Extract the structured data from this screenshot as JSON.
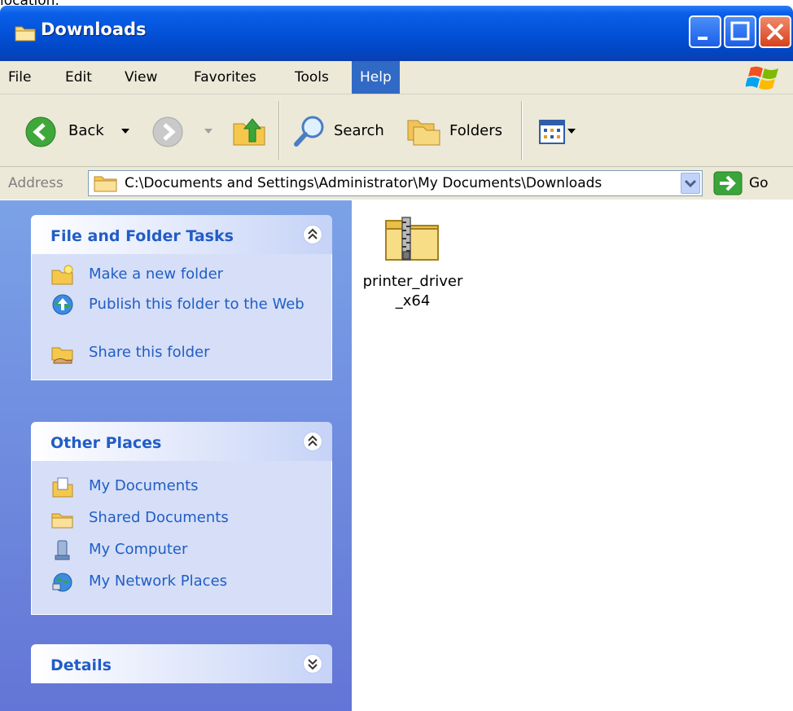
{
  "partial_text": "location.",
  "window": {
    "title": "Downloads",
    "controls": [
      "minimize",
      "maximize",
      "close"
    ]
  },
  "menu": {
    "items": [
      "File",
      "Edit",
      "View",
      "Favorites",
      "Tools",
      "Help"
    ],
    "active": "Help"
  },
  "toolbar": {
    "back_label": "Back",
    "search_label": "Search",
    "folders_label": "Folders"
  },
  "address": {
    "label": "Address",
    "path": "C:\\Documents and Settings\\Administrator\\My Documents\\Downloads",
    "go_label": "Go"
  },
  "panels": {
    "file_tasks": {
      "title": "File and Folder Tasks",
      "items": [
        "Make a new folder",
        "Publish this folder to the Web",
        "Share this folder"
      ]
    },
    "other_places": {
      "title": "Other Places",
      "items": [
        "My Documents",
        "Shared Documents",
        "My Computer",
        "My Network Places"
      ]
    },
    "details": {
      "title": "Details"
    }
  },
  "files": [
    {
      "name_line1": "printer_driver",
      "name_line2": "_x64",
      "icon": "zip-folder-icon"
    }
  ],
  "colors": {
    "titlebar": "#0351d8",
    "accent": "#316ac5",
    "task_link": "#215dc6",
    "pane_background": "#7ba2e7"
  }
}
